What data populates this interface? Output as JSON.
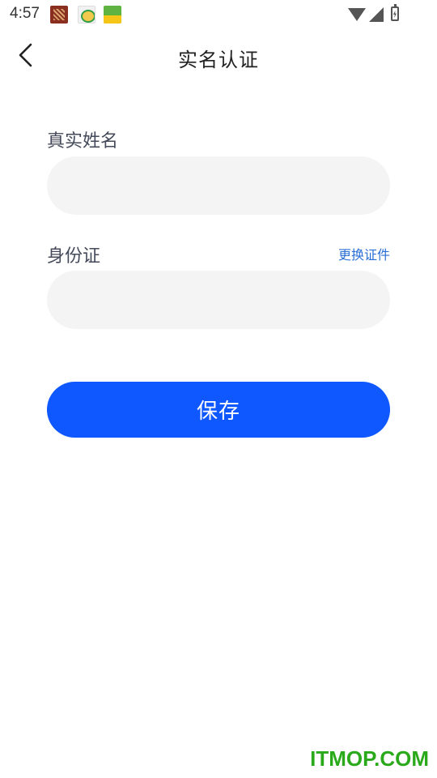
{
  "status_bar": {
    "time": "4:57",
    "notification_icons": [
      "app-notification-icon",
      "app-notification-icon",
      "app-notification-icon"
    ],
    "right_icons": [
      "wifi-icon",
      "signal-icon",
      "battery-charging-icon"
    ]
  },
  "header": {
    "title": "实名认证",
    "back_icon": "chevron-left-icon"
  },
  "form": {
    "name_label": "真实姓名",
    "name_value": "",
    "id_label": "身份证",
    "id_value": "",
    "change_doc_label": "更换证件",
    "save_label": "保存"
  },
  "colors": {
    "primary": "#0f57ff",
    "link": "#2a6fd6",
    "input_bg": "#f4f4f4",
    "label": "#444a5a",
    "watermark": "#2aa91b"
  },
  "watermark": {
    "text": "ITMOP.COM"
  }
}
